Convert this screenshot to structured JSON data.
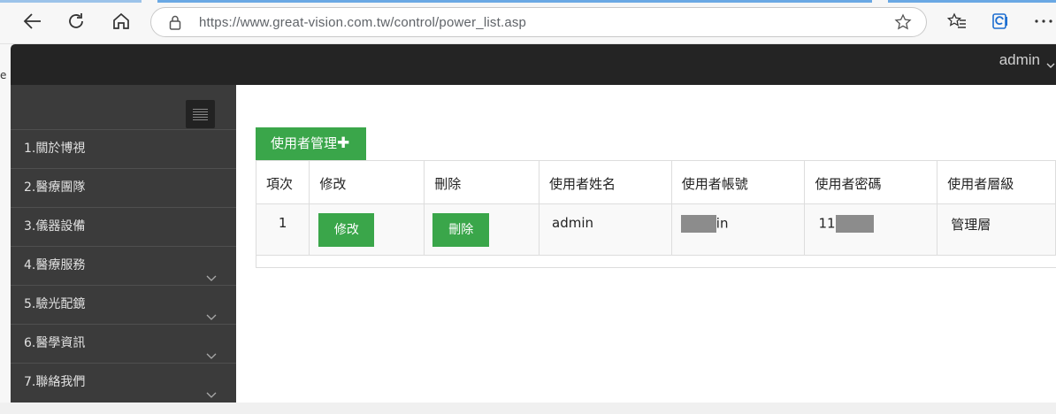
{
  "browser": {
    "url": "https://www.great-vision.com.tw/control/power_list.asp",
    "left_stub_char": "e"
  },
  "topbar": {
    "user": "admin"
  },
  "sidebar": {
    "items": [
      {
        "label": "1.關於博視",
        "has_submenu": false
      },
      {
        "label": "2.醫療團隊",
        "has_submenu": false
      },
      {
        "label": "3.儀器設備",
        "has_submenu": false
      },
      {
        "label": "4.醫療服務",
        "has_submenu": true
      },
      {
        "label": "5.驗光配鏡",
        "has_submenu": true
      },
      {
        "label": "6.醫學資訊",
        "has_submenu": true
      },
      {
        "label": "7.聯絡我們",
        "has_submenu": true
      }
    ]
  },
  "main": {
    "tab_label": "使用者管理",
    "table": {
      "headers": [
        "項次",
        "修改",
        "刪除",
        "使用者姓名",
        "使用者帳號",
        "使用者密碼",
        "使用者層級"
      ],
      "rows": [
        {
          "index": "1",
          "edit_label": "修改",
          "delete_label": "刪除",
          "name": "admin",
          "account_visible": "in",
          "password_visible": "11",
          "level": "管理層"
        }
      ]
    }
  },
  "colors": {
    "accent": "#3aa64a",
    "topbar": "#242424",
    "sidebar": "#3b3b3b"
  }
}
